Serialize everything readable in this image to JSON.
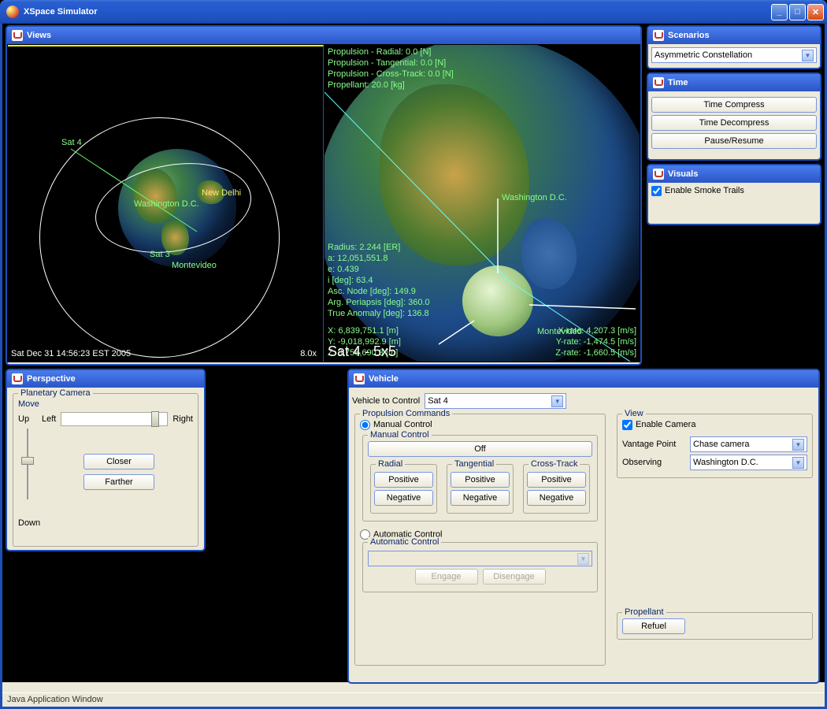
{
  "window": {
    "title": "XSpace Simulator"
  },
  "statusbar": "Java Application Window",
  "views": {
    "title": "Views",
    "left": {
      "timestamp": "Sat Dec 31 14:56:23 EST 2005",
      "speed": "8.0x",
      "labels": {
        "sat4": "Sat 4",
        "sat3": "Sat 3",
        "newdelhi": "New Delhi",
        "washington": "Washington D.C.",
        "montevideo": "Montevideo"
      }
    },
    "right": {
      "title": "Sat 4 - 5x5",
      "propulsion": {
        "radial": "Propulsion - Radial: 0.0 [N]",
        "tangential": "Propulsion - Tangential: 0.0 [N]",
        "crosstrack": "Propulsion - Cross-Track: 0.0 [N]",
        "propellant": "Propellant: 20.0 [kg]"
      },
      "orbit": {
        "radius": "Radius: 2.244 [ER]",
        "a": "a: 12,051,551.8",
        "e": "e: 0.439",
        "i": "i [deg]: 63.4",
        "asc": "Asc. Node [deg]: 149.9",
        "arg": "Arg. Periapsis [deg]: 360.0",
        "true": "True Anomaly [deg]: 136.8"
      },
      "pos": {
        "x": "X: 6,839,751.1 [m]",
        "y": "Y: -9,018,992.9 [m]",
        "z": "Z: 8,756,690.3 [m]"
      },
      "rates": {
        "xr": "X-rate: 4,207.3 [m/s]",
        "yr": "Y-rate: -1,474.5 [m/s]",
        "zr": "Z-rate: -1,660.5 [m/s]"
      },
      "labels": {
        "washington": "Washington D.C.",
        "montevideo": "Montevideo"
      }
    }
  },
  "scenarios": {
    "title": "Scenarios",
    "selected": "Asymmetric Constellation"
  },
  "time": {
    "title": "Time",
    "compress": "Time Compress",
    "decompress": "Time Decompress",
    "pause": "Pause/Resume"
  },
  "visuals": {
    "title": "Visuals",
    "smoke": "Enable Smoke Trails"
  },
  "perspective": {
    "title": "Perspective",
    "group": "Planetary Camera",
    "move": "Move",
    "up": "Up",
    "left": "Left",
    "right": "Right",
    "down": "Down",
    "closer": "Closer",
    "farther": "Farther"
  },
  "vehicle": {
    "title": "Vehicle",
    "controlLabel": "Vehicle to Control",
    "controlValue": "Sat 4",
    "propGroup": "Propulsion Commands",
    "manual": "Manual Control",
    "manualGroup": "Manual Control",
    "off": "Off",
    "radial": "Radial",
    "tangential": "Tangential",
    "crosstrack": "Cross-Track",
    "positive": "Positive",
    "negative": "Negative",
    "automatic": "Automatic Control",
    "autoGroup": "Automatic Control",
    "engage": "Engage",
    "disengage": "Disengage",
    "viewGroup": "View",
    "enableCam": "Enable Camera",
    "vantageLabel": "Vantage Point",
    "vantageValue": "Chase camera",
    "observingLabel": "Observing",
    "observingValue": "Washington D.C.",
    "propellantGroup": "Propellant",
    "refuel": "Refuel"
  }
}
